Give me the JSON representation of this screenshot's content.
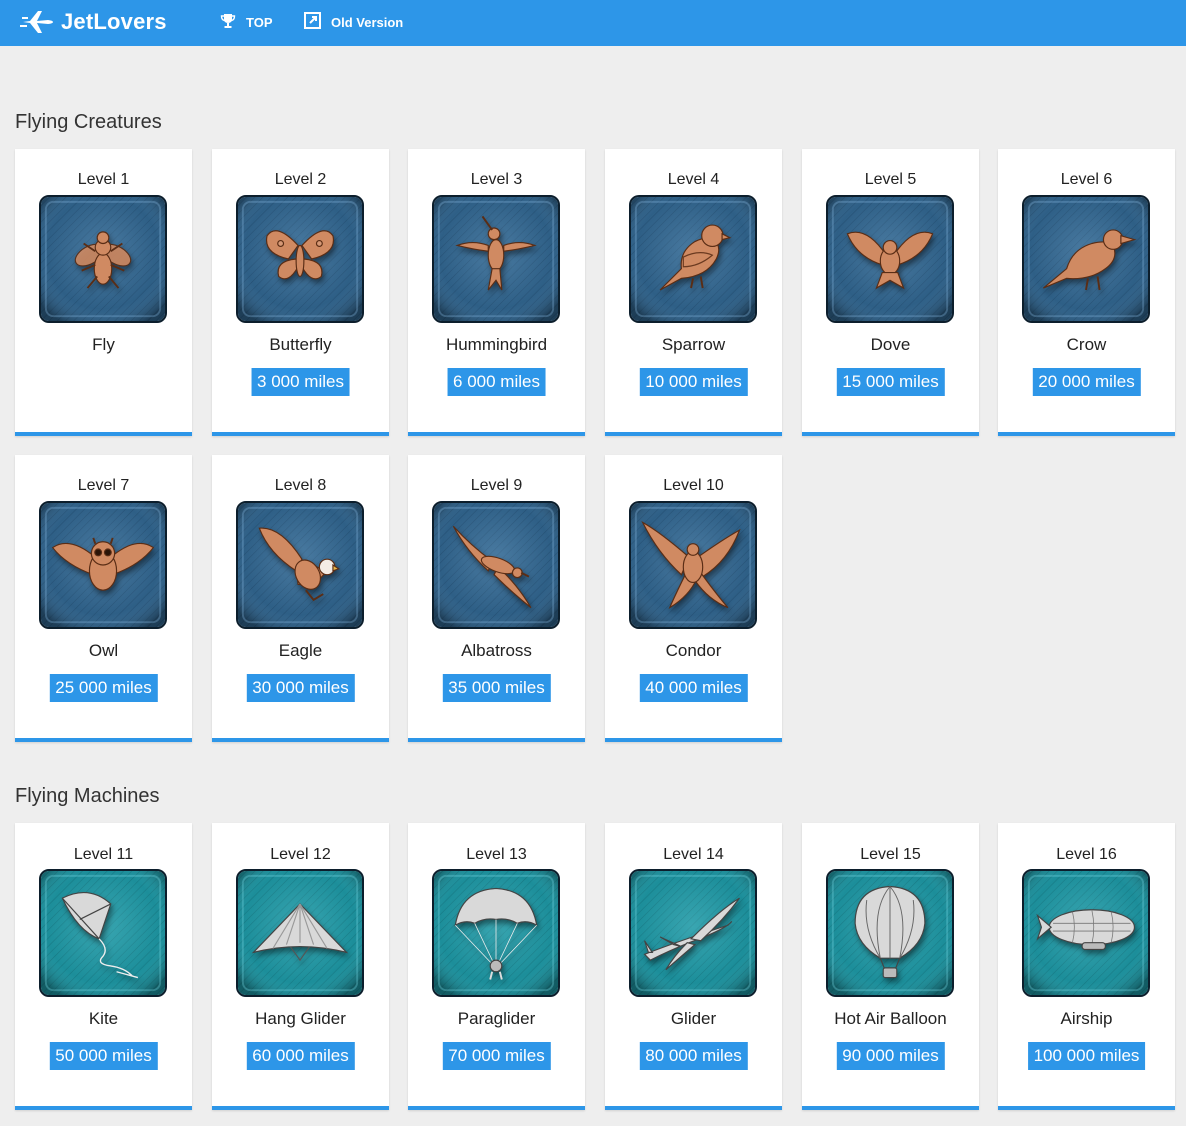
{
  "header": {
    "brand": "JetLovers",
    "nav": [
      {
        "label": "TOP",
        "icon": "trophy-icon"
      },
      {
        "label": "Old Version",
        "icon": "external-link-icon"
      }
    ]
  },
  "colors": {
    "accent": "#2d96e8",
    "creature_badge": "#2e5f86",
    "machine_badge": "#1c8e9a",
    "creature_figure": "#d08a62",
    "machine_figure": "#d9d9d9"
  },
  "sections": [
    {
      "title": "Flying Creatures",
      "items": [
        {
          "level": "Level 1",
          "name": "Fly",
          "miles": "",
          "icon": "fly-icon"
        },
        {
          "level": "Level 2",
          "name": "Butterfly",
          "miles": "3 000 miles",
          "icon": "butterfly-icon"
        },
        {
          "level": "Level 3",
          "name": "Hummingbird",
          "miles": "6 000 miles",
          "icon": "hummingbird-icon"
        },
        {
          "level": "Level 4",
          "name": "Sparrow",
          "miles": "10 000 miles",
          "icon": "sparrow-icon"
        },
        {
          "level": "Level 5",
          "name": "Dove",
          "miles": "15 000 miles",
          "icon": "dove-icon"
        },
        {
          "level": "Level 6",
          "name": "Crow",
          "miles": "20 000 miles",
          "icon": "crow-icon"
        },
        {
          "level": "Level 7",
          "name": "Owl",
          "miles": "25 000 miles",
          "icon": "owl-icon"
        },
        {
          "level": "Level 8",
          "name": "Eagle",
          "miles": "30 000 miles",
          "icon": "eagle-icon"
        },
        {
          "level": "Level 9",
          "name": "Albatross",
          "miles": "35 000 miles",
          "icon": "albatross-icon"
        },
        {
          "level": "Level 10",
          "name": "Condor",
          "miles": "40 000 miles",
          "icon": "condor-icon"
        }
      ]
    },
    {
      "title": "Flying Machines",
      "items": [
        {
          "level": "Level 11",
          "name": "Kite",
          "miles": "50 000 miles",
          "icon": "kite-icon"
        },
        {
          "level": "Level 12",
          "name": "Hang Glider",
          "miles": "60 000 miles",
          "icon": "hang-glider-icon"
        },
        {
          "level": "Level 13",
          "name": "Paraglider",
          "miles": "70 000 miles",
          "icon": "paraglider-icon"
        },
        {
          "level": "Level 14",
          "name": "Glider",
          "miles": "80 000 miles",
          "icon": "glider-icon"
        },
        {
          "level": "Level 15",
          "name": "Hot Air Balloon",
          "miles": "90 000 miles",
          "icon": "hot-air-balloon-icon"
        },
        {
          "level": "Level 16",
          "name": "Airship",
          "miles": "100 000 miles",
          "icon": "airship-icon"
        }
      ]
    }
  ]
}
